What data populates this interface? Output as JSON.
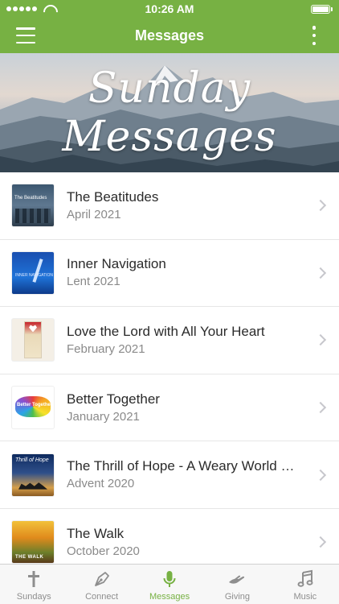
{
  "status_bar": {
    "time": "10:26 AM"
  },
  "nav": {
    "title": "Messages"
  },
  "banner": {
    "line1": "Sunday",
    "line2": "Messages"
  },
  "messages": [
    {
      "title": "The Beatitudes",
      "subtitle": "April 2021",
      "thumb_text": "The Beatitudes"
    },
    {
      "title": "Inner Navigation",
      "subtitle": "Lent 2021",
      "thumb_text": "INNER NAVIGATION"
    },
    {
      "title": "Love the Lord with All Your Heart",
      "subtitle": "February 2021",
      "thumb_text": ""
    },
    {
      "title": "Better Together",
      "subtitle": "January 2021",
      "thumb_text": "Better Together"
    },
    {
      "title": "The Thrill of Hope - A Weary World Rejoices",
      "subtitle": "Advent 2020",
      "thumb_text": "Thrill of Hope"
    },
    {
      "title": "The Walk",
      "subtitle": "October 2020",
      "thumb_text": "THE WALK"
    }
  ],
  "tabs": [
    {
      "label": "Sundays",
      "icon": "cross-icon",
      "active": false
    },
    {
      "label": "Connect",
      "icon": "pen-icon",
      "active": false
    },
    {
      "label": "Messages",
      "icon": "microphone-icon",
      "active": true
    },
    {
      "label": "Giving",
      "icon": "giving-hand-icon",
      "active": false
    },
    {
      "label": "Music",
      "icon": "music-note-icon",
      "active": false
    }
  ],
  "colors": {
    "accent": "#77b143",
    "inactive_tab": "#8e8e8e"
  }
}
